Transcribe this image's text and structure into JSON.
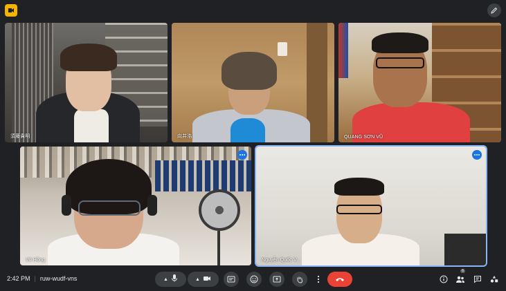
{
  "meeting": {
    "time": "2:42 PM",
    "code": "ruw-wudf-vns"
  },
  "participants": [
    {
      "name": "須藤貴明"
    },
    {
      "name": "向井浩"
    },
    {
      "name": "QUANG SƠN VŨ"
    },
    {
      "name": "Vũ Hồng"
    },
    {
      "name": "Nguyễn Quốc V..."
    }
  ],
  "people_count": "6",
  "colors": {
    "accent": "#8ab4f8",
    "end_call": "#ea4335",
    "logo": "#f5b400"
  },
  "icons": {
    "mic": "mic-icon",
    "camera": "camera-icon",
    "captions": "captions-icon",
    "emoji": "emoji-icon",
    "present": "present-icon",
    "hand": "raise-hand-icon",
    "more": "more-vert-icon",
    "end": "end-call-icon",
    "info": "info-icon",
    "people": "people-icon",
    "chat": "chat-icon",
    "activities": "activities-icon"
  }
}
